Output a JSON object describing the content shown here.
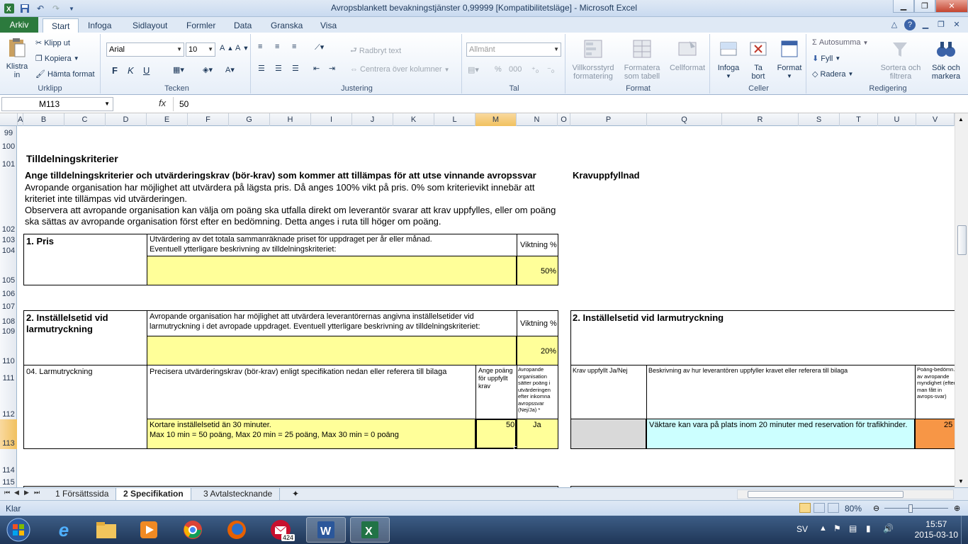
{
  "window": {
    "title": "Avropsblankett bevakningstjänster 0,99999  [Kompatibilitetsläge]  -  Microsoft Excel"
  },
  "ribbon_tabs": [
    "Arkiv",
    "Start",
    "Infoga",
    "Sidlayout",
    "Formler",
    "Data",
    "Granska",
    "Visa"
  ],
  "ribbon": {
    "clipboard": {
      "paste": "Klistra",
      "paste2": "in",
      "cut": "Klipp ut",
      "copy": "Kopiera",
      "format_painter": "Hämta format",
      "label": "Urklipp"
    },
    "font": {
      "name": "Arial",
      "size": "10",
      "bold": "F",
      "italic": "K",
      "underline": "U",
      "label": "Tecken"
    },
    "alignment": {
      "wrap": "Radbryt text",
      "merge": "Centrera över kolumner",
      "label": "Justering"
    },
    "number": {
      "format": "Allmänt",
      "percent": "%",
      "label": "Tal"
    },
    "styles": {
      "conditional": "Villkorsstyrd",
      "conditional2": "formatering",
      "as_table": "Formatera",
      "as_table2": "som tabell",
      "cell_styles": "Cellformat",
      "label": "Format"
    },
    "cells": {
      "insert": "Infoga",
      "delete": "Ta",
      "delete2": "bort",
      "format": "Format",
      "label": "Celler"
    },
    "editing": {
      "autosum": "Autosumma",
      "fill": "Fyll",
      "clear": "Radera",
      "sort": "Sortera och",
      "sort2": "filtrera",
      "find": "Sök och",
      "find2": "markera",
      "label": "Redigering"
    }
  },
  "formula_bar": {
    "name_box": "M113",
    "fx": "fx",
    "value": "50"
  },
  "columns": [
    "A",
    "B",
    "C",
    "D",
    "E",
    "F",
    "G",
    "H",
    "I",
    "J",
    "K",
    "L",
    "M",
    "N",
    "O",
    "P",
    "Q",
    "R",
    "S",
    "T",
    "U",
    "V"
  ],
  "rows": [
    "99",
    "100",
    "101",
    "102",
    "103",
    "104",
    "105",
    "106",
    "107",
    "108",
    "109",
    "110",
    "111",
    "112",
    "113",
    "114",
    "115"
  ],
  "sheet": {
    "heading": "Tilldelningskriterier",
    "subheading": "Ange tilldelningskriterier och utvärderingskrav (bör-krav) som kommer att tillämpas för att utse vinnande avropssvar",
    "intro1": "Avropande organisation har möjlighet att utvärdera på lägsta pris. Då anges 100% vikt på pris. 0% som kriterievikt innebär att",
    "intro2": "kriteriet inte tillämpas vid utvärderingen.",
    "intro3": "Observera att avropande organisation kan välja om poäng ska utfalla direkt om leverantör svarar att krav uppfylles, eller om poäng",
    "intro4": "ska sättas av avropande organisation först efter en bedömning. Detta anges i ruta till höger om poäng.",
    "kravuppfyllnad": "Kravuppfyllnad",
    "pris": {
      "title": "1. Pris",
      "desc1": "Utvärdering av det totala sammanräknade priset för uppdraget per år eller månad.",
      "desc2": "Eventuell ytterligare beskrivning av tilldelningskriteriet:",
      "weight_label": "Viktning %",
      "weight": "50%"
    },
    "setup": {
      "title1": "2. Inställelsetid vid",
      "title2": "larmutryckning",
      "desc1": "Avropande organisation har möjlighet att utvärdera leverantörernas angivna inställelsetider vid",
      "desc2": "larmutryckning i det avropade uppdraget. Eventuell ytterligare beskrivning av tilldelningskriteriet:",
      "weight_label": "Viktning %",
      "weight": "20%",
      "item": "04. Larmutryckning",
      "precise": "Precisera utvärderingskrav (bör-krav) enligt specifikation nedan eller referera till bilaga",
      "points_label": "Ange poäng för uppfyllt krav",
      "org_label": "Avropande organisation sätter poäng i utvärderingen efter inkomna avropssvar (Nej/Ja) *",
      "req1": "Kortare inställelsetid än 30 minuter.",
      "req2": "Max 10 min = 50 poäng, Max 20 min = 25 poäng, Max 30 min = 0 poäng",
      "points": "50",
      "org_value": "Ja"
    },
    "right": {
      "title": "2. Inställelsetid vid larmutryckning",
      "col1": "Krav uppfyllt Ja/Nej",
      "col2": "Beskrivning av hur leverantören uppfyller kravet eller referera till bilaga",
      "col3": "Poäng-bedömn. av avropande myndighet (efter man fått in avrops-svar)",
      "answer": "Väktare kan vara på plats inom 20 minuter med reservation för trafikhinder.",
      "score": "25"
    }
  },
  "sheet_tabs": [
    "1 Försättssida",
    "2 Specifikation",
    "3 Avtalstecknande"
  ],
  "status": {
    "ready": "Klar",
    "zoom": "80%"
  },
  "taskbar": {
    "lang": "SV",
    "time": "15:57",
    "date": "2015-03-10",
    "mail_badge": "424"
  },
  "colors": {
    "excel_green": "#2c7a3d",
    "input_yellow": "#ffff99",
    "answer_cyan": "#ccffff",
    "score_orange": "#f79646",
    "selection": "#f1c15f"
  }
}
